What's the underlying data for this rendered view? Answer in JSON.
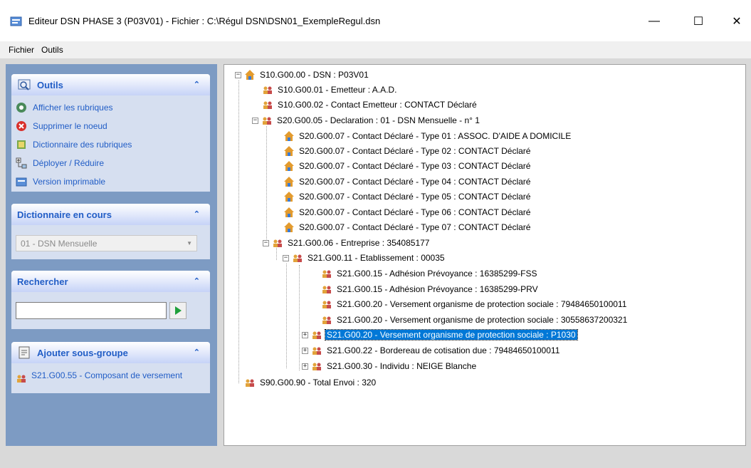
{
  "window": {
    "title": "Editeur DSN PHASE 3 (P03V01) - Fichier : C:\\Régul DSN\\DSN01_ExempleRegul.dsn",
    "min_symbol": "—",
    "max_symbol": "☐",
    "close_symbol": "✕"
  },
  "menu": {
    "items": [
      "Fichier",
      "Outils"
    ]
  },
  "sidebar": {
    "outils": {
      "title": "Outils",
      "items": [
        {
          "label": "Afficher les rubriques",
          "icon": "view-icon"
        },
        {
          "label": "Supprimer le noeud",
          "icon": "delete-icon"
        },
        {
          "label": "Dictionnaire des rubriques",
          "icon": "book-icon"
        },
        {
          "label": "Déployer / Réduire",
          "icon": "expand-icon"
        },
        {
          "label": "Version imprimable",
          "icon": "print-icon"
        }
      ]
    },
    "dictionnaire": {
      "title": "Dictionnaire en cours",
      "selected": "01 - DSN Mensuelle"
    },
    "rechercher": {
      "title": "Rechercher",
      "value": ""
    },
    "ajouter": {
      "title": "Ajouter sous-groupe",
      "item": "S21.G00.55 - Composant de versement"
    }
  },
  "tree": {
    "nodes": [
      {
        "label": "S10.G00.00 - DSN : P03V01",
        "icon": "home-icon",
        "expander": "−"
      },
      {
        "label": "S10.G00.01 - Emetteur : A.A.D.",
        "icon": "people-icon"
      },
      {
        "label": "S10.G00.02 - Contact Emetteur : CONTACT Déclaré",
        "icon": "people-icon"
      },
      {
        "label": "S20.G00.05 - Declaration : 01 - DSN Mensuelle - n° 1",
        "icon": "people-icon",
        "expander": "−"
      },
      {
        "label": "S20.G00.07 - Contact Déclaré - Type 01 : ASSOC. D'AIDE A DOMICILE",
        "icon": "home-icon"
      },
      {
        "label": "S20.G00.07 - Contact Déclaré - Type 02 : CONTACT Déclaré",
        "icon": "home-icon"
      },
      {
        "label": "S20.G00.07 - Contact Déclaré - Type 03 : CONTACT Déclaré",
        "icon": "home-icon"
      },
      {
        "label": "S20.G00.07 - Contact Déclaré - Type 04 : CONTACT Déclaré",
        "icon": "home-icon"
      },
      {
        "label": "S20.G00.07 - Contact Déclaré - Type 05 : CONTACT Déclaré",
        "icon": "home-icon"
      },
      {
        "label": "S20.G00.07 - Contact Déclaré - Type 06 : CONTACT Déclaré",
        "icon": "home-icon"
      },
      {
        "label": "S20.G00.07 - Contact Déclaré - Type 07 : CONTACT Déclaré",
        "icon": "home-icon"
      },
      {
        "label": "S21.G00.06 - Entreprise : 354085177",
        "icon": "people-icon",
        "expander": "−"
      },
      {
        "label": "S21.G00.11 - Etablissement : 00035",
        "icon": "people-icon",
        "expander": "−"
      },
      {
        "label": "S21.G00.15 - Adhésion Prévoyance : 16385299-FSS",
        "icon": "people-icon"
      },
      {
        "label": "S21.G00.15 - Adhésion Prévoyance : 16385299-PRV",
        "icon": "people-icon"
      },
      {
        "label": "S21.G00.20 - Versement organisme de protection sociale : 79484650100011",
        "icon": "people-icon"
      },
      {
        "label": "S21.G00.20 - Versement organisme de protection sociale : 30558637200321",
        "icon": "people-icon"
      },
      {
        "label": "S21.G00.20 - Versement organisme de protection sociale : P1030",
        "icon": "people-icon",
        "expander": "+",
        "selected": true
      },
      {
        "label": "S21.G00.22 - Bordereau de cotisation due : 79484650100011",
        "icon": "people-icon",
        "expander": "+"
      },
      {
        "label": "S21.G00.30 - Individu : NEIGE Blanche",
        "icon": "people-icon",
        "expander": "+"
      },
      {
        "label": "S90.G00.90 - Total Envoi : 320",
        "icon": "people-icon"
      }
    ]
  },
  "colors": {
    "sidebar_bg": "#7d9bc3",
    "panel_title": "#215dc6",
    "selection": "#0078d7"
  }
}
